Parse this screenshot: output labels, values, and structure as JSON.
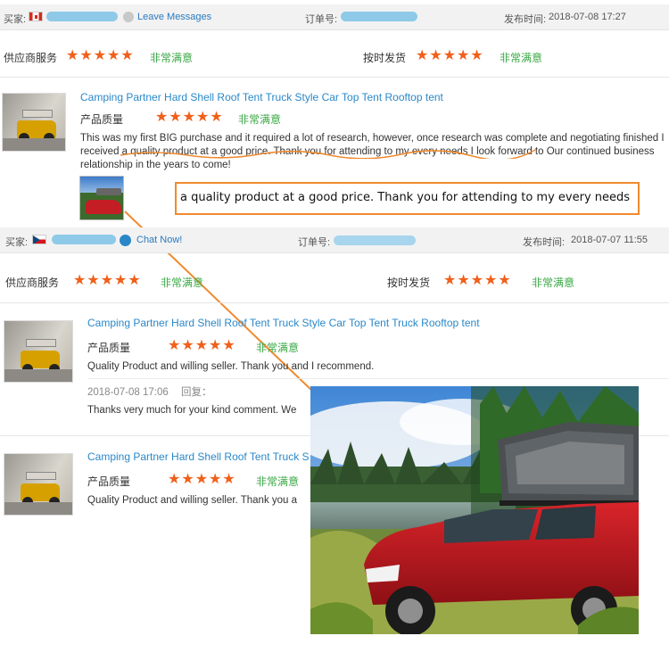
{
  "review1": {
    "buyer_label": "买家:",
    "leave_messages": "Leave Messages",
    "order_label": "订单号:",
    "time_label": "发布时间:",
    "time_value": "2018-07-08 17:27",
    "supplier_service": "供应商服务",
    "supplier_rating_text": "非常满意",
    "on_time": "按时发货",
    "on_time_rating_text": "非常满意",
    "product_title": "Camping Partner Hard Shell Roof Tent Truck Style Car Top Tent Rooftop tent",
    "quality_label": "产品质量",
    "quality_rating_text": "非常满意",
    "comment": "This was my first BIG purchase and it required a lot of research, however, once research was complete and negotiating finished I received a quality product at a good price. Thank you for attending to my every needs I look forward to Our continued business relationship in the years to come!"
  },
  "callout_text": "a quality product at a good price. Thank you for attending to my every needs",
  "review2": {
    "buyer_label": "买家:",
    "chat_now": "Chat Now!",
    "order_label": "订单号:",
    "time_label": "发布时间:",
    "time_value": "2018-07-07 11:55",
    "supplier_service": "供应商服务",
    "supplier_rating_text": "非常满意",
    "on_time": "按时发货",
    "on_time_rating_text": "非常满意",
    "items": [
      {
        "product_title": "Camping Partner Hard Shell Roof Tent Truck Style Car Top Tent Truck Rooftop tent",
        "quality_label": "产品质量",
        "quality_rating_text": "非常满意",
        "comment": "Quality Product and willing seller. Thank you and I recommend.",
        "reply_time": "2018-07-08 17:06",
        "reply_label": "回复：",
        "reply_text": "Thanks very much for your kind comment. We"
      },
      {
        "product_title": "Camping Partner Hard Shell Roof Tent Truck S",
        "quality_label": "产品质量",
        "quality_rating_text": "非常满意",
        "comment": "Quality Product and willing seller. Thank you a"
      }
    ]
  },
  "stars": "★★★★★",
  "ratings": {
    "supplier_service": 5,
    "on_time": 5,
    "quality": 5,
    "max": 5
  },
  "colors": {
    "star": "#f0601a",
    "satisfied": "#3aa845",
    "link": "#2a88c8",
    "callout_border": "#f08a2e"
  }
}
